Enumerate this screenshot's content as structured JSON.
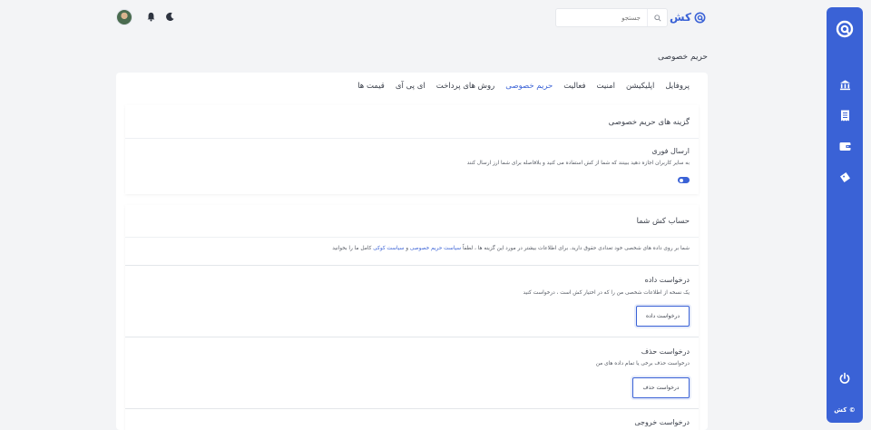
{
  "brand": {
    "name": "کش",
    "color": "#3a62d6"
  },
  "header": {
    "search_placeholder": "جستجو",
    "search_icon": "search-icon",
    "bell_icon": "bell-icon",
    "moon_icon": "moon-icon"
  },
  "page": {
    "title": "حریم خصوصی"
  },
  "tabs": [
    {
      "label": "پروفایل",
      "active": false
    },
    {
      "label": "اپلیکیشن",
      "active": false
    },
    {
      "label": "امنیت",
      "active": false
    },
    {
      "label": "فعالیت",
      "active": false
    },
    {
      "label": "حریم خصوصی",
      "active": true
    },
    {
      "label": "روش های پرداخت",
      "active": false
    },
    {
      "label": "ای پی آی",
      "active": false
    },
    {
      "label": "قیمت ها",
      "active": false
    }
  ],
  "privacy_options": {
    "heading": "گزینه های حریم خصوصی",
    "instant_send": {
      "title": "ارسال فوری",
      "description": "به سایر کاربران اجازه دهید ببینند که شما از کش استفاده می کنید و بلافاصله برای شما ارز ارسال کنند",
      "enabled": true
    }
  },
  "account": {
    "heading": "حساب کش شما",
    "rights_text": "شما بر روی داده های شخصی خود تعدادی حقوق دارید. برای اطلاعات بیشتر در مورد این گزینه ها ، لطفاً",
    "privacy_link": "سیاست حریم خصوصی",
    "and_word": "و",
    "cookie_link": "سیاست کوکی",
    "rights_tail": "کامل ما را بخوانید",
    "data_request": {
      "title": "درخواست داده",
      "description": "یک نسخه از اطلاعات شخصی من را که در اختیار کش است ، درخواست کنید",
      "button": "درخواست داده"
    },
    "delete_request": {
      "title": "درخواست حذف",
      "description": "درخواست حذف برخی یا تمام داده های من",
      "button": "درخواست حذف"
    },
    "exit_request": {
      "title": "درخواست خروجی"
    }
  },
  "sidebar": {
    "icons": [
      "logo-icon",
      "bank-icon",
      "receipt-icon",
      "wallet-icon",
      "tag-icon",
      "power-icon"
    ],
    "footer": "© کش"
  }
}
